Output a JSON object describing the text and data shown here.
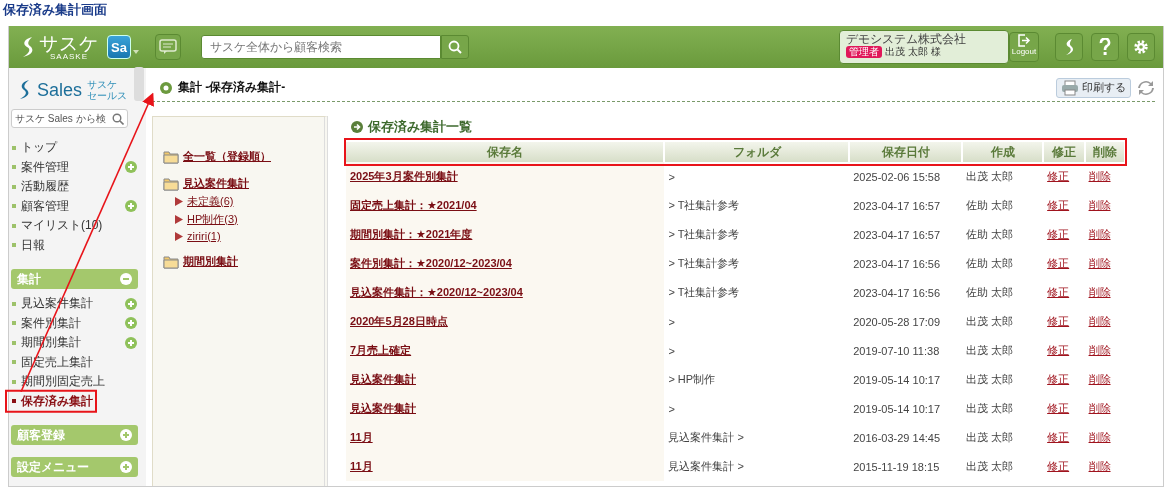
{
  "page_title": "保存済み集計画面",
  "header": {
    "logo": "サスケ",
    "logo_sub": "SAASKE",
    "app_badge": "Sa",
    "search": {
      "placeholder": "サスケ全体から顧客検索"
    },
    "company": "デモシステム株式会社",
    "role": "管理者",
    "user": "出茂 太郎 様",
    "logout": "Logout"
  },
  "sidebar": {
    "brand": "Sales",
    "brand_sub": [
      "サスケ",
      "セールス"
    ],
    "search": {
      "placeholder": "サスケ Sales から検"
    },
    "nav": [
      {
        "label": "トップ",
        "add": false,
        "selected": false
      },
      {
        "label": "案件管理",
        "add": true,
        "selected": false
      },
      {
        "label": "活動履歴",
        "add": false,
        "selected": false
      },
      {
        "label": "顧客管理",
        "add": true,
        "selected": false
      },
      {
        "label": "マイリスト(10)",
        "add": false,
        "selected": false
      },
      {
        "label": "日報",
        "add": false,
        "selected": false
      }
    ],
    "groups": [
      {
        "title": "集計",
        "expanded": true,
        "items": [
          {
            "label": "見込案件集計",
            "add": true,
            "selected": false
          },
          {
            "label": "案件別集計",
            "add": true,
            "selected": false
          },
          {
            "label": "期間別集計",
            "add": true,
            "selected": false
          },
          {
            "label": "固定売上集計",
            "add": false,
            "selected": false
          },
          {
            "label": "期間別固定売上",
            "add": false,
            "selected": false
          },
          {
            "label": "保存済み集計",
            "add": false,
            "selected": true
          }
        ]
      },
      {
        "title": "顧客登録",
        "expanded": false
      },
      {
        "title": "設定メニュー",
        "expanded": false
      }
    ]
  },
  "main": {
    "title": "集計 -保存済み集計-",
    "print_button": "印刷する",
    "folders": [
      {
        "label": "全一覧（登録順）"
      },
      {
        "label": "見込案件集計",
        "children": [
          {
            "label": "未定義(6)"
          },
          {
            "label": "HP制作(3)"
          },
          {
            "label": "ziriri(1)"
          }
        ]
      },
      {
        "label": "期間別集計"
      }
    ],
    "list_title": "保存済み集計一覧",
    "table": {
      "columns": [
        "保存名",
        "フォルダ",
        "保存日付",
        "作成",
        "修正",
        "削除"
      ],
      "rows": [
        {
          "name": "2025年3月案件別集計",
          "folder": ">",
          "saved": "2025-02-06 15:58",
          "author": "出茂 太郎",
          "edit": "修正",
          "delete": "削除"
        },
        {
          "name": "固定売上集計：★2021/04",
          "folder": "> T社集計参考",
          "saved": "2023-04-17 16:57",
          "author": "佐助 太郎",
          "edit": "修正",
          "delete": "削除"
        },
        {
          "name": "期間別集計：★2021年度",
          "folder": "> T社集計参考",
          "saved": "2023-04-17 16:57",
          "author": "佐助 太郎",
          "edit": "修正",
          "delete": "削除"
        },
        {
          "name": "案件別集計：★2020/12~2023/04",
          "folder": "> T社集計参考",
          "saved": "2023-04-17 16:56",
          "author": "佐助 太郎",
          "edit": "修正",
          "delete": "削除"
        },
        {
          "name": "見込案件集計：★2020/12~2023/04",
          "folder": "> T社集計参考",
          "saved": "2023-04-17 16:56",
          "author": "佐助 太郎",
          "edit": "修正",
          "delete": "削除"
        },
        {
          "name": "2020年5月28日時点",
          "folder": ">",
          "saved": "2020-05-28 17:09",
          "author": "出茂 太郎",
          "edit": "修正",
          "delete": "削除"
        },
        {
          "name": "7月売上確定",
          "folder": ">",
          "saved": "2019-07-10 11:38",
          "author": "出茂 太郎",
          "edit": "修正",
          "delete": "削除"
        },
        {
          "name": "見込案件集計",
          "folder": "> HP制作",
          "saved": "2019-05-14 10:17",
          "author": "出茂 太郎",
          "edit": "修正",
          "delete": "削除"
        },
        {
          "name": "見込案件集計",
          "folder": ">",
          "saved": "2019-05-14 10:17",
          "author": "出茂 太郎",
          "edit": "修正",
          "delete": "削除"
        },
        {
          "name": "11月",
          "folder": "見込案件集計 >",
          "saved": "2016-03-29 14:45",
          "author": "出茂 太郎",
          "edit": "修正",
          "delete": "削除"
        },
        {
          "name": "11月",
          "folder": "見込案件集計 >",
          "saved": "2015-11-19 18:15",
          "author": "出茂 太郎",
          "edit": "修正",
          "delete": "削除"
        }
      ]
    }
  }
}
